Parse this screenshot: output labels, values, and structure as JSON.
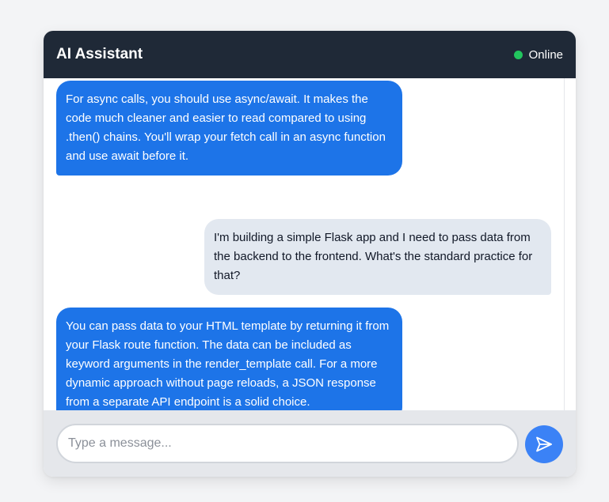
{
  "header": {
    "title": "AI Assistant",
    "status": "Online",
    "status_color": "#22c55e"
  },
  "colors": {
    "header_bg": "#1f2937",
    "ai_bubble": "#1d74e8",
    "user_bubble": "#e2e8f0",
    "send_button": "#3b82f6"
  },
  "messages": [
    {
      "role": "assistant",
      "text": "For async calls, you should use async/await. It makes the code much cleaner and easier to read compared to using .then() chains. You'll wrap your fetch call in an async function and use await before it."
    },
    {
      "role": "user",
      "text": "I'm building a simple Flask app and I need to pass data from the backend to the frontend. What's the standard practice for that?"
    },
    {
      "role": "assistant",
      "text": "You can pass data to your HTML template by returning it from your Flask route function. The data can be included as keyword arguments in the render_template call. For a more dynamic approach without page reloads, a JSON response from a separate API endpoint is a solid choice."
    },
    {
      "role": "user",
      "text": ""
    }
  ],
  "composer": {
    "placeholder": "Type a message...",
    "value": "",
    "send_icon": "send-icon"
  }
}
